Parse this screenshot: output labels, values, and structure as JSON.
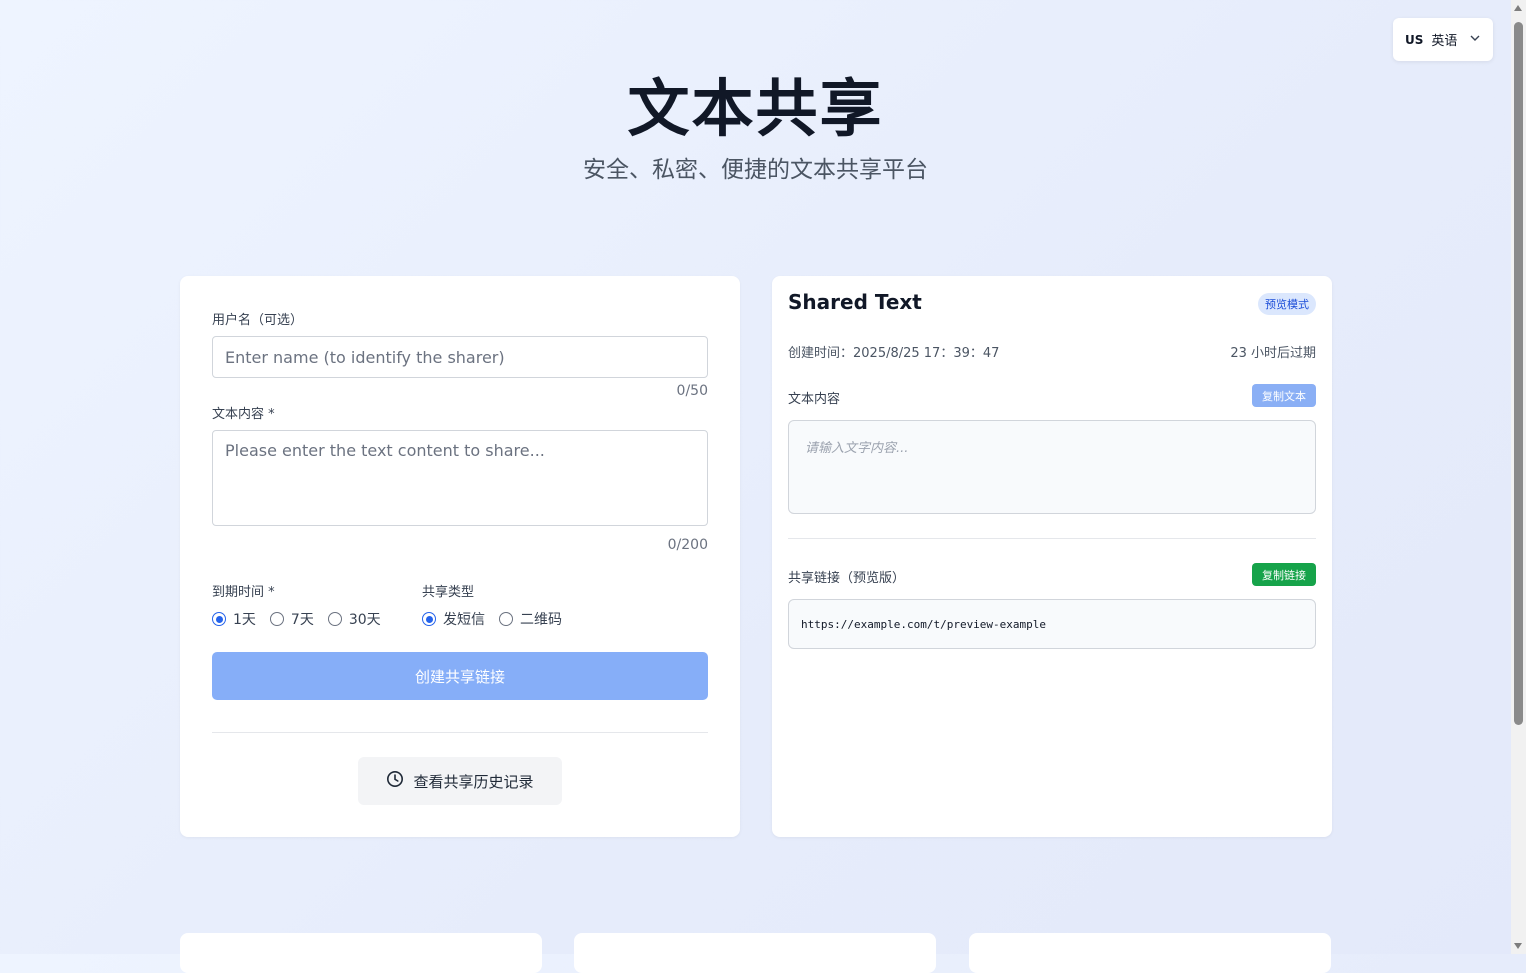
{
  "language_selector": {
    "flag": "US",
    "label": "英语"
  },
  "hero": {
    "title": "文本共享",
    "subtitle": "安全、私密、便捷的文本共享平台"
  },
  "form": {
    "username_label": "用户名（可选）",
    "username_placeholder": "Enter name (to identify the sharer)",
    "username_value": "",
    "username_counter": "0/50",
    "content_label": "文本内容 *",
    "content_placeholder": "Please enter the text content to share...",
    "content_value": "",
    "content_counter": "0/200",
    "expiry_label": "到期时间 *",
    "expiry_options": [
      {
        "label": "1天",
        "selected": true
      },
      {
        "label": "7天",
        "selected": false
      },
      {
        "label": "30天",
        "selected": false
      }
    ],
    "share_type_label": "共享类型",
    "share_type_options": [
      {
        "label": "发短信",
        "selected": true
      },
      {
        "label": "二维码",
        "selected": false
      }
    ],
    "create_button": "创建共享链接",
    "history_button": "查看共享历史记录"
  },
  "preview": {
    "title": "Shared Text",
    "badge": "预览模式",
    "created": "创建时间：2025/8/25 17：39：47",
    "expires": "23 小时后过期",
    "content_label": "文本内容",
    "copy_text_button": "复制文本",
    "content_placeholder": "请输入文字内容...",
    "link_label": "共享链接（预览版）",
    "copy_link_button": "复制链接",
    "link_value": "https://example.com/t/preview-example"
  },
  "colors": {
    "primary": "#2563eb",
    "create_button": "#86aef8",
    "copy_link": "#16a34a",
    "copy_text": "#8aaff5",
    "badge_bg": "#dbe7fd"
  }
}
